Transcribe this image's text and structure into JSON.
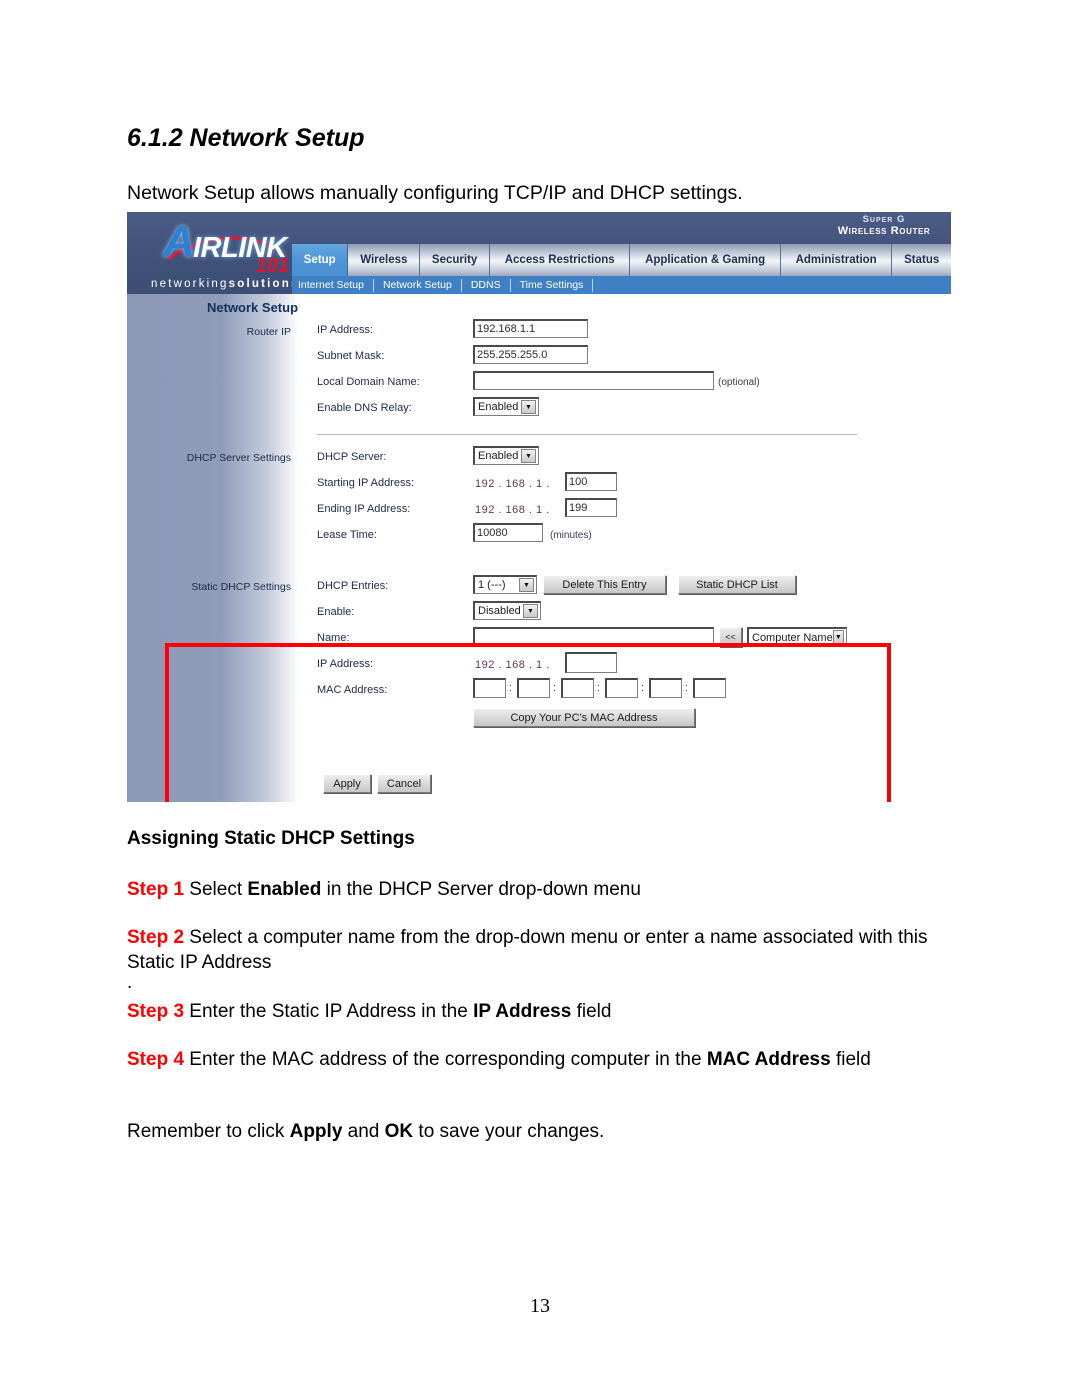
{
  "document": {
    "section_number": "6.1.2",
    "section_title": "6.1.2 Network Setup",
    "intro": "Network Setup allows manually configuring TCP/IP and DHCP settings.",
    "subheading": "Assigning Static DHCP Settings",
    "page_number": "13"
  },
  "router_ui": {
    "brand": {
      "logo_letter": "A",
      "logo_word": "IRLINK",
      "logo_number": "101",
      "tagline_light": "networking",
      "tagline_bold": "solutions",
      "badge_line1": "Super G",
      "badge_line2": "Wireless Router"
    },
    "tabs": [
      {
        "label": "Setup",
        "active": true
      },
      {
        "label": "Wireless",
        "active": false
      },
      {
        "label": "Security",
        "active": false
      },
      {
        "label": "Access Restrictions",
        "active": false
      },
      {
        "label": "Application & Gaming",
        "active": false
      },
      {
        "label": "Administration",
        "active": false
      },
      {
        "label": "Status",
        "active": false
      }
    ],
    "subtabs": [
      {
        "label": "Internet Setup"
      },
      {
        "label": "Network Setup"
      },
      {
        "label": "DDNS"
      },
      {
        "label": "Time Settings"
      }
    ],
    "panel_title": "Network Setup",
    "sections": {
      "router_ip": {
        "label": "Router IP",
        "fields": {
          "ip_address_label": "IP Address:",
          "ip_address_value": "192.168.1.1",
          "subnet_mask_label": "Subnet Mask:",
          "subnet_mask_value": "255.255.255.0",
          "local_domain_label": "Local Domain Name:",
          "local_domain_value": "",
          "local_domain_note": "(optional)",
          "dns_relay_label": "Enable DNS Relay:",
          "dns_relay_value": "Enabled"
        }
      },
      "dhcp_server": {
        "label": "DHCP Server Settings",
        "fields": {
          "dhcp_server_label": "DHCP Server:",
          "dhcp_server_value": "Enabled",
          "starting_ip_label": "Starting IP Address:",
          "starting_ip_prefix": "192 . 168 .  1  .",
          "starting_ip_value": "100",
          "ending_ip_label": "Ending IP Address:",
          "ending_ip_prefix": "192 . 168 .  1  .",
          "ending_ip_value": "199",
          "lease_time_label": "Lease Time:",
          "lease_time_value": "10080",
          "lease_time_note": "(minutes)"
        }
      },
      "static_dhcp": {
        "label": "Static DHCP Settings",
        "highlighted": true,
        "highlight_color": "#ff0000",
        "fields": {
          "dhcp_entries_label": "DHCP Entries:",
          "dhcp_entries_value": "1 (---)",
          "delete_entry_button": "Delete This Entry",
          "static_list_button": "Static DHCP List",
          "enable_label": "Enable:",
          "enable_value": "Disabled",
          "name_label": "Name:",
          "name_value": "",
          "insert_button": "<<",
          "computer_name_value": "Computer Name",
          "ip_address_label": "IP Address:",
          "ip_address_prefix": "192 . 168 .  1  .",
          "ip_address_value": "",
          "mac_address_label": "MAC Address:",
          "mac_octets": [
            "",
            "",
            "",
            "",
            "",
            ""
          ],
          "mac_separator": ":",
          "copy_mac_button": "Copy Your PC's MAC Address"
        }
      }
    },
    "footer_buttons": {
      "apply": "Apply",
      "cancel": "Cancel"
    }
  },
  "steps": [
    {
      "num": "Step 1",
      "parts": [
        {
          "t": " Select ",
          "b": false
        },
        {
          "t": "Enabled",
          "b": true
        },
        {
          "t": " in the DHCP Server drop-down menu",
          "b": false
        }
      ]
    },
    {
      "num": "Step 2",
      "parts": [
        {
          "t": " Select a computer name from the drop-down menu or enter a name associated with this Static IP Address",
          "b": false
        }
      ]
    },
    {
      "num": "Step 3",
      "parts": [
        {
          "t": " Enter the Static IP Address in the ",
          "b": false
        },
        {
          "t": "IP Address",
          "b": true
        },
        {
          "t": " field",
          "b": false
        }
      ]
    },
    {
      "num": "Step 4",
      "parts": [
        {
          "t": " Enter the MAC address of the corresponding computer in the ",
          "b": false
        },
        {
          "t": "MAC Address",
          "b": true
        },
        {
          "t": " field",
          "b": false
        }
      ]
    }
  ],
  "stray_mark": ".",
  "closing": {
    "pre": "Remember to click ",
    "b1": "Apply",
    "mid": " and ",
    "b2": "OK",
    "post": " to save your changes."
  }
}
